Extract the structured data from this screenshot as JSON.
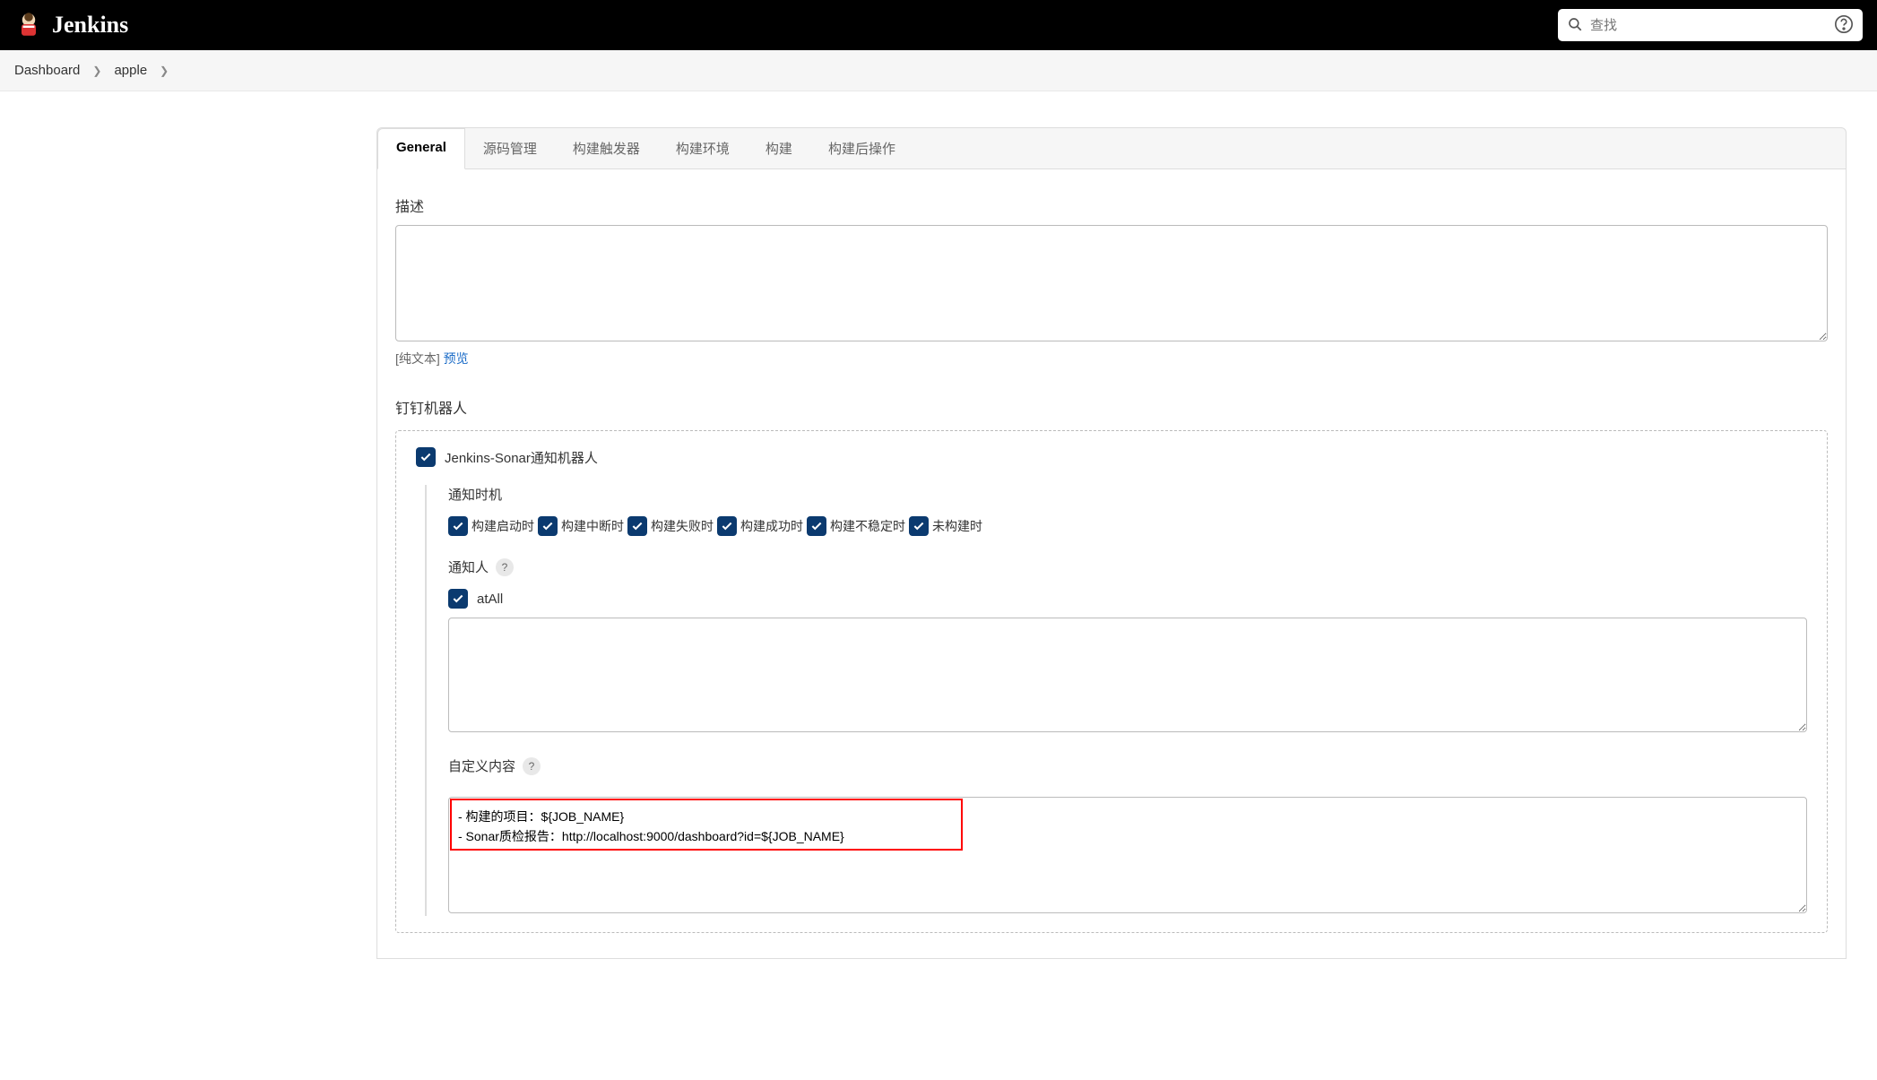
{
  "header": {
    "title": "Jenkins",
    "search_placeholder": "查找"
  },
  "breadcrumb": [
    {
      "label": "Dashboard"
    },
    {
      "label": "apple"
    }
  ],
  "tabs": [
    {
      "label": "General",
      "active": true
    },
    {
      "label": "源码管理",
      "active": false
    },
    {
      "label": "构建触发器",
      "active": false
    },
    {
      "label": "构建环境",
      "active": false
    },
    {
      "label": "构建",
      "active": false
    },
    {
      "label": "构建后操作",
      "active": false
    }
  ],
  "form": {
    "description_label": "描述",
    "description_value": "",
    "format_plain": "[纯文本]",
    "format_preview": "预览",
    "robot_section_title": "钉钉机器人",
    "robot_name": "Jenkins-Sonar通知机器人",
    "robot_checked": true,
    "timing_label": "通知时机",
    "timing_options": [
      {
        "label": "构建启动时",
        "checked": true
      },
      {
        "label": "构建中断时",
        "checked": true
      },
      {
        "label": "构建失败时",
        "checked": true
      },
      {
        "label": "构建成功时",
        "checked": true
      },
      {
        "label": "构建不稳定时",
        "checked": true
      },
      {
        "label": "未构建时",
        "checked": true
      }
    ],
    "notify_people_label": "通知人",
    "atall_label": "atAll",
    "atall_checked": true,
    "atall_textarea_value": "",
    "custom_content_label": "自定义内容",
    "custom_content_value": "- 构建的项目：${JOB_NAME}\n- Sonar质检报告：http://localhost:9000/dashboard?id=${JOB_NAME}"
  },
  "colors": {
    "checkbox_bg": "#0b3a6f",
    "link": "#1a6bc7",
    "highlight_border": "#f00"
  }
}
